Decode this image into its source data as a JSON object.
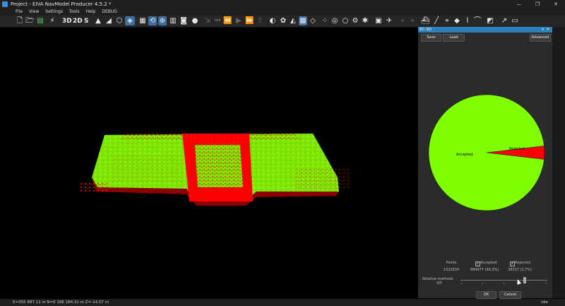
{
  "window": {
    "title": "Project - EIVA NavModel Producer 4.5.2 *",
    "minimize": "—",
    "maximize": "❐",
    "close": "✕"
  },
  "menu": [
    "File",
    "View",
    "Settings",
    "Tools",
    "Help",
    "DEBUG"
  ],
  "toolbar": {
    "view_3d": "3D",
    "view_2d": "2D",
    "view_s": "S"
  },
  "panel": {
    "title": "EC-3D",
    "header_buttons": [
      "▾",
      "✕"
    ],
    "save_label": "Save",
    "load_label": "Load",
    "advanced_label": "Advanced",
    "stats": {
      "points_label": "Points",
      "points_value": "1022634",
      "accepted_label": "Accepted",
      "accepted_value": "984477 (96,3%)",
      "rejected_label": "Rejected",
      "rejected_value": "38157 (3,7%)",
      "accepted_checked": "✓",
      "rejected_checked": "✓"
    },
    "relative_methods_label": "Relative methods",
    "relative_methods_value": "4/5",
    "slider_position": 0.75,
    "ok_label": "OK",
    "cancel_label": "Cancel"
  },
  "chart_data": {
    "type": "pie",
    "slices": [
      {
        "label": "Accepted",
        "value": 96.3,
        "color": "#7fff00"
      },
      {
        "label": "Rejected",
        "value": 3.7,
        "color": "#ff0000"
      }
    ]
  },
  "status": {
    "coords": "E=355 987,11 m N=6 166 184,31 m Z=-14,57 m",
    "state": "Idle"
  },
  "colors": {
    "accent": "#2f7fb8",
    "accepted": "#7fff00",
    "rejected": "#ff0000"
  }
}
